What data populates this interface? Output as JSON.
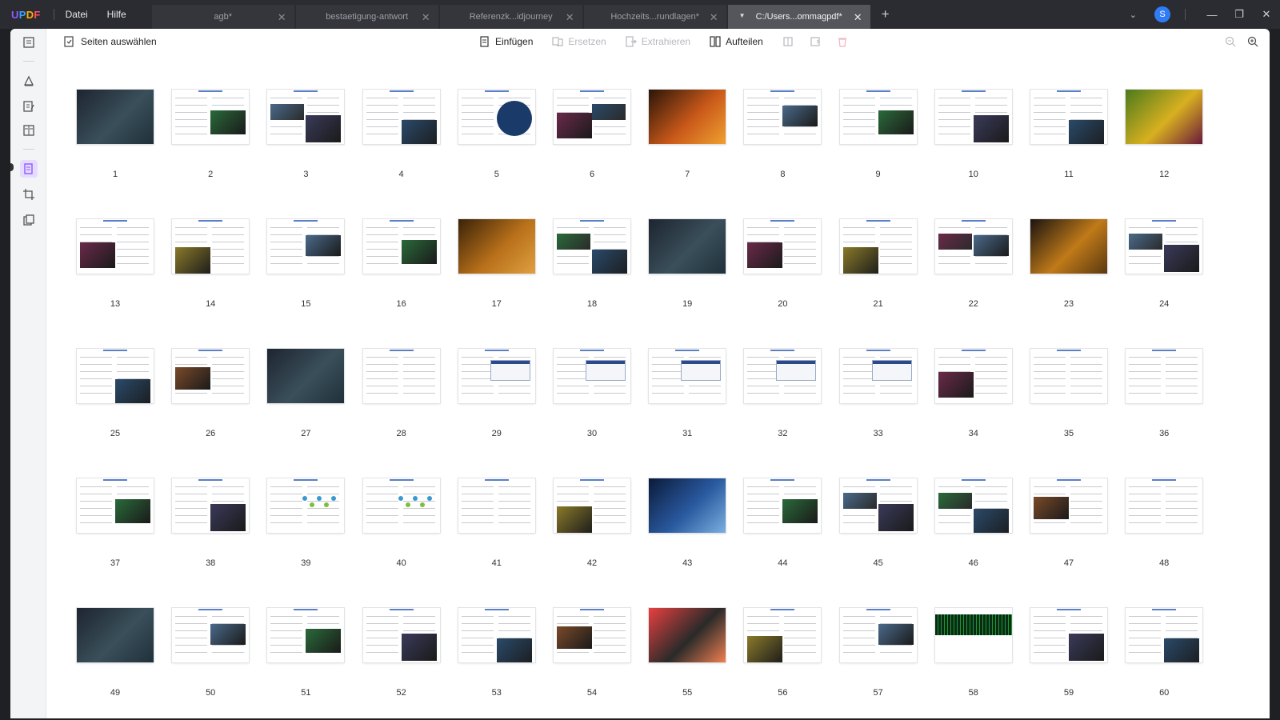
{
  "titlebar": {
    "logo": "UPDF",
    "menu": [
      "Datei",
      "Hilfe"
    ],
    "tabs": [
      {
        "label": "agb*",
        "active": false
      },
      {
        "label": "bestaetigung-antwort",
        "active": false
      },
      {
        "label": "Referenzk...idjourney",
        "active": false
      },
      {
        "label": "Hochzeits...rundlagen*",
        "active": false
      },
      {
        "label": "C:/Users...ommagpdf*",
        "active": true
      }
    ],
    "avatar_initial": "S"
  },
  "toolbar": {
    "select_pages": "Seiten auswählen",
    "insert": "Einfügen",
    "replace": "Ersetzen",
    "extract": "Extrahieren",
    "split": "Aufteilen"
  },
  "colors": {
    "accent": "#8e5cff",
    "titlebar": "#2b2c31",
    "active_tab": "#55565c"
  },
  "pages": {
    "count": 60,
    "labels": [
      "1",
      "2",
      "3",
      "4",
      "5",
      "6",
      "7",
      "8",
      "9",
      "10",
      "11",
      "12",
      "13",
      "14",
      "15",
      "16",
      "17",
      "18",
      "19",
      "20",
      "21",
      "22",
      "23",
      "24",
      "25",
      "26",
      "27",
      "28",
      "29",
      "30",
      "31",
      "32",
      "33",
      "34",
      "35",
      "36",
      "37",
      "38",
      "39",
      "40",
      "41",
      "42",
      "43",
      "44",
      "45",
      "46",
      "47",
      "48",
      "49",
      "50",
      "51",
      "52",
      "53",
      "54",
      "55",
      "56",
      "57",
      "58",
      "59",
      "60"
    ],
    "thumbnail_styles": [
      "photo-dark",
      "text-photo",
      "grid-photos",
      "text-photo",
      "text-circle",
      "text-photos",
      "photo-fire",
      "text-photo",
      "text-photo",
      "text-photo",
      "text-photo",
      "photo-flower",
      "text-photo",
      "text-photo",
      "text-photo",
      "text-photo",
      "photo-sunset",
      "text-photos",
      "photo-dark",
      "text-photo",
      "text-photo",
      "text-photos",
      "photo-bee",
      "text-photos",
      "text-photo",
      "text-photo",
      "photo-dark",
      "text",
      "text-screens",
      "text-screens",
      "text-screens",
      "text-screens",
      "text-screens",
      "text-photo",
      "text",
      "text",
      "text-photo",
      "text-photo",
      "text-diagram",
      "text-diagram",
      "text",
      "text-photo",
      "photo-blue",
      "text-photo",
      "text-photos",
      "text-photos",
      "text-photo",
      "text",
      "photo-dark",
      "text-photo",
      "text-photo",
      "text-photo",
      "text-photo",
      "text-photo",
      "photo-red",
      "text-photo",
      "text-photo",
      "photo-matrix",
      "text-photo",
      "text-photo"
    ]
  }
}
